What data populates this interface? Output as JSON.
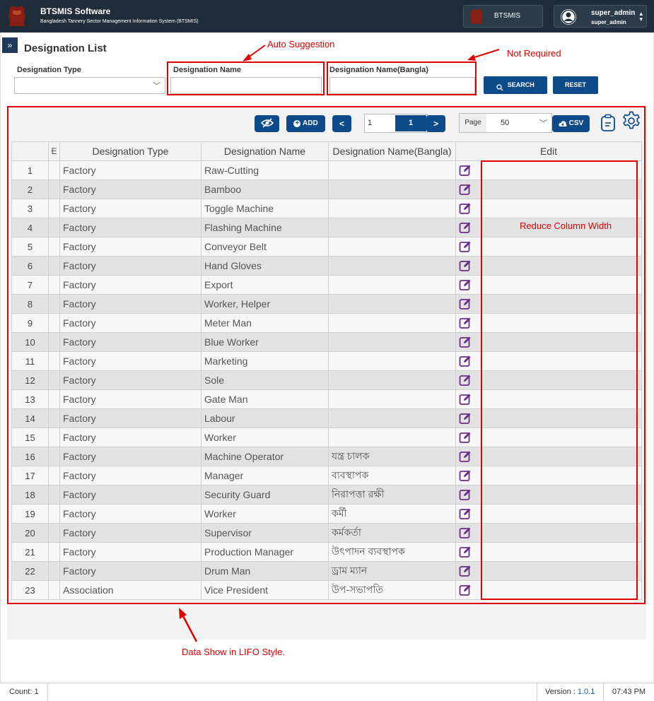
{
  "header": {
    "app_title": "BTSMIS Software",
    "app_subtitle": "Bangladesh Tannery Sector Management Information System (BTSMIS)",
    "system_button": "BTSMIS",
    "user_name": "super_admin",
    "user_role": "super_admin"
  },
  "page": {
    "title": "Designation List"
  },
  "filters": {
    "type_label": "Designation Type",
    "type_value": "",
    "name_label": "Designation Name",
    "name_value": "",
    "bangla_label": "Designation Name(Bangla)",
    "bangla_value": "",
    "search_label": "SEARCH",
    "reset_label": "RESET"
  },
  "toolbar": {
    "add_label": "ADD",
    "prev_label": "<",
    "next_label": ">",
    "page_input": "1",
    "current_page": "1",
    "page_size_label": "Page",
    "page_size_value": "50",
    "csv_label": "CSV"
  },
  "table": {
    "columns": [
      "",
      "E",
      "Designation Type",
      "Designation Name",
      "Designation Name(Bangla)",
      "Edit"
    ],
    "rows": [
      {
        "num": "1",
        "type": "Factory",
        "name": "Raw-Cutting",
        "bangla": ""
      },
      {
        "num": "2",
        "type": "Factory",
        "name": "Bamboo",
        "bangla": ""
      },
      {
        "num": "3",
        "type": "Factory",
        "name": "Toggle Machine",
        "bangla": ""
      },
      {
        "num": "4",
        "type": "Factory",
        "name": "Flashing Machine",
        "bangla": ""
      },
      {
        "num": "5",
        "type": "Factory",
        "name": "Conveyor Belt",
        "bangla": ""
      },
      {
        "num": "6",
        "type": "Factory",
        "name": "Hand Gloves",
        "bangla": ""
      },
      {
        "num": "7",
        "type": "Factory",
        "name": "Export",
        "bangla": ""
      },
      {
        "num": "8",
        "type": "Factory",
        "name": "Worker, Helper",
        "bangla": ""
      },
      {
        "num": "9",
        "type": "Factory",
        "name": "Meter Man",
        "bangla": ""
      },
      {
        "num": "10",
        "type": "Factory",
        "name": "Blue Worker",
        "bangla": ""
      },
      {
        "num": "11",
        "type": "Factory",
        "name": "Marketing",
        "bangla": ""
      },
      {
        "num": "12",
        "type": "Factory",
        "name": "Sole",
        "bangla": ""
      },
      {
        "num": "13",
        "type": "Factory",
        "name": "Gate Man",
        "bangla": ""
      },
      {
        "num": "14",
        "type": "Factory",
        "name": "Labour",
        "bangla": ""
      },
      {
        "num": "15",
        "type": "Factory",
        "name": "Worker",
        "bangla": ""
      },
      {
        "num": "16",
        "type": "Factory",
        "name": "Machine Operator",
        "bangla": "যন্ত্র চালক"
      },
      {
        "num": "17",
        "type": "Factory",
        "name": "Manager",
        "bangla": "ব্যবস্থাপক"
      },
      {
        "num": "18",
        "type": "Factory",
        "name": "Security Guard",
        "bangla": "নিরাপত্তা রক্ষী"
      },
      {
        "num": "19",
        "type": "Factory",
        "name": "Worker",
        "bangla": "কর্মী"
      },
      {
        "num": "20",
        "type": "Factory",
        "name": "Supervisor",
        "bangla": "কর্মকর্তা"
      },
      {
        "num": "21",
        "type": "Factory",
        "name": "Production Manager",
        "bangla": "উৎপাদন ব্যবস্থাপক"
      },
      {
        "num": "22",
        "type": "Factory",
        "name": "Drum Man",
        "bangla": "ড্রাম ম্যান"
      },
      {
        "num": "23",
        "type": "Association",
        "name": "Vice President",
        "bangla": "উপ-সভাপতি"
      }
    ]
  },
  "annotations": {
    "auto_suggestion": "Auto Suggestion",
    "not_required": "Not Required",
    "reduce_width": "Reduce Column Width",
    "lifo": "Data Show in LIFO Style."
  },
  "footer": {
    "count": "Count: 1",
    "version_label": "Version : ",
    "version_value": "1.0.1",
    "time": "07:43 PM"
  },
  "colors": {
    "header_bg": "#1f2d3a",
    "primary_button": "#0d4a8a",
    "annotation_red": "#e00000",
    "edit_icon": "#6a2c8a"
  }
}
